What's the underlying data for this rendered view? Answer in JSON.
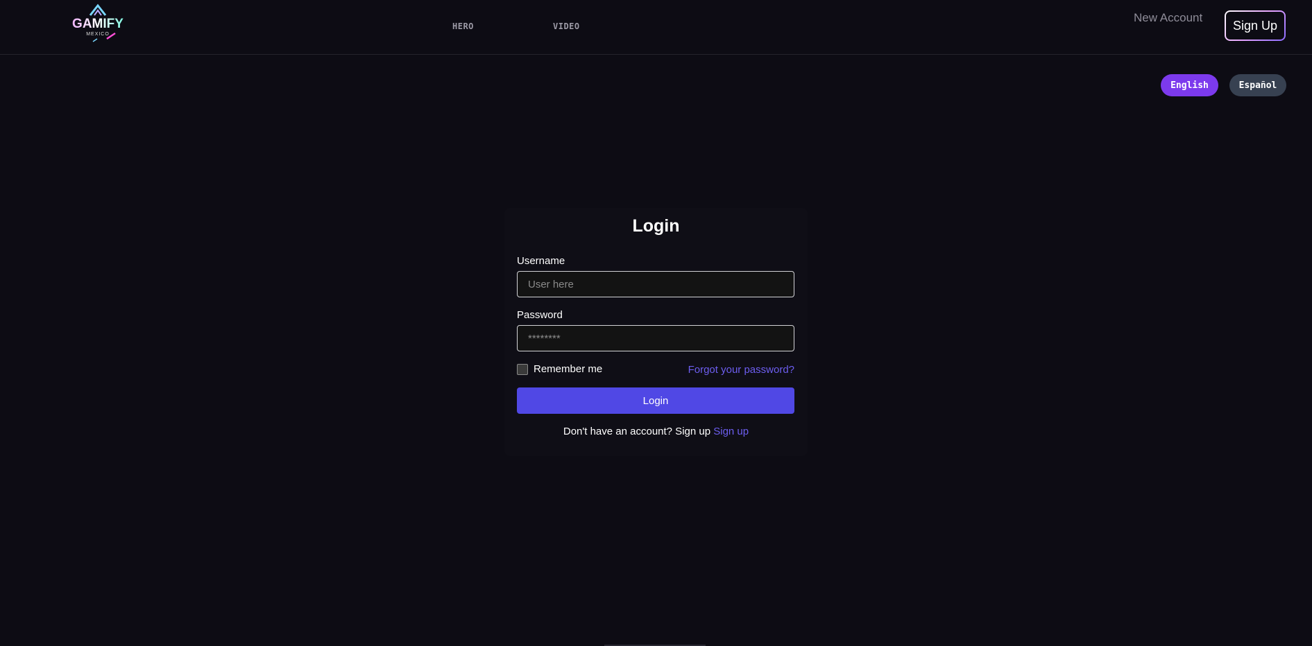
{
  "header": {
    "logo": {
      "icon": "gamify-mexico-logo",
      "brand": "GAMIFY",
      "sub": "MEXICO"
    },
    "nav": [
      {
        "label": "HERO"
      },
      {
        "label": "VIDEO"
      }
    ],
    "new_account_label": "New Account",
    "sign_up_label": "Sign Up"
  },
  "language": {
    "english_label": "English",
    "spanish_label": "Español",
    "active": "English",
    "active_color": "#7c3aed",
    "inactive_color": "#374151"
  },
  "login": {
    "title": "Login",
    "username_label": "Username",
    "username_placeholder": "User here",
    "password_label": "Password",
    "password_placeholder": "********",
    "remember_label": "Remember me",
    "forgot_label": "Forgot your password?",
    "submit_label": "Login",
    "no_account_text": "Don't have an account? Sign up",
    "signup_link_label": "Sign up",
    "accent_color": "#5048e5"
  }
}
